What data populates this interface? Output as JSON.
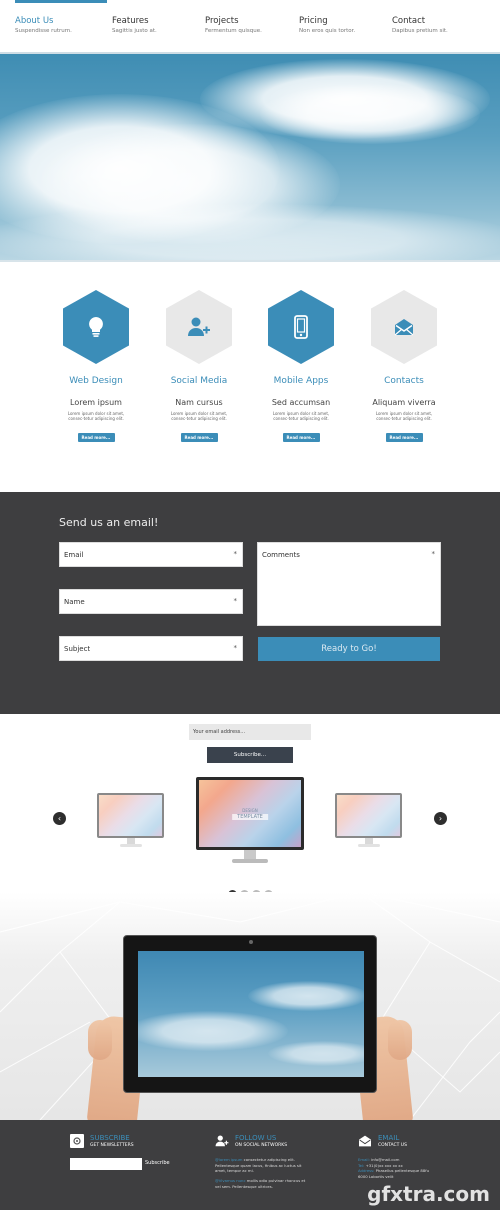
{
  "nav": {
    "items": [
      {
        "title": "About Us",
        "subtitle": "Suspendisse rutrum.",
        "active": true
      },
      {
        "title": "Features",
        "subtitle": "Sagittis justo at.",
        "active": false
      },
      {
        "title": "Projects",
        "subtitle": "Fermentum quisque.",
        "active": false
      },
      {
        "title": "Pricing",
        "subtitle": "Non eros quis tortor.",
        "active": false
      },
      {
        "title": "Contact",
        "subtitle": "Dapibus pretium sit.",
        "active": false
      }
    ]
  },
  "features": [
    {
      "icon": "lightbulb-icon",
      "title": "Web Design",
      "subtitle": "Lorem ipsum",
      "desc": "Lorem ipsum dolor sit amet, consec-tetur adipiscing elit.",
      "button": "Read more..."
    },
    {
      "icon": "add-user-icon",
      "title": "Social Media",
      "subtitle": "Nam cursus",
      "desc": "Lorem ipsum dolor sit amet, consec-tetur adipiscing elit.",
      "button": "Read more..."
    },
    {
      "icon": "smartphone-icon",
      "title": "Mobile Apps",
      "subtitle": "Sed accumsan",
      "desc": "Lorem ipsum dolor sit amet, consec-tetur adipiscing elit.",
      "button": "Read more..."
    },
    {
      "icon": "open-envelope-icon",
      "title": "Contacts",
      "subtitle": "Aliquam viverra",
      "desc": "Lorem ipsum dolor sit amet, consec-tetur adipiscing elit.",
      "button": "Read more..."
    }
  ],
  "contact": {
    "heading": "Send us an email!",
    "fields": {
      "email": "Email",
      "name": "Name",
      "subject": "Subject",
      "comments": "Comments"
    },
    "required_mark": "*",
    "submit": "Ready to Go!"
  },
  "subscribe": {
    "placeholder": "Your email address...",
    "button": "Subscribe..."
  },
  "showcase": {
    "banner_line1": "DESIGN",
    "banner_line2": "TEMPLATE",
    "prev": "‹",
    "next": "›",
    "slides_total": 4,
    "active_slide": 1
  },
  "footer": {
    "subscribe": {
      "heading": "SUBSCRIBE",
      "sub": "GET NEWSLETTERS",
      "button": "Subscribe"
    },
    "follow": {
      "heading": "FOLLOW US",
      "sub": "ON SOCIAL NETWORKS",
      "p1_hl": "@lorem ipsum",
      "p1": " consectetur adipiscing elit. Pellentesque quam lacus, finibus ac luctus sit amet, tempor ac mi.",
      "p2_hl": "@Vivamus nunc",
      "p2": " mollis odio pulvinar rhoncus et vel sem. Pellentesque ultrices."
    },
    "email": {
      "heading": "EMAIL",
      "sub": "CONTACT US",
      "email_label": "Email:",
      "email_value": "info@mail.com",
      "tel_label": "Tel:",
      "tel_value": "+31(0)xx xxx xx xx",
      "address_label": "Address:",
      "address_value": "Phasellus pellentesque 88fu 6000 Lobortis velit"
    }
  },
  "watermark": "gfxtra.com",
  "colors": {
    "accent": "#3b8db8",
    "dark": "#3e3e40",
    "hex_gray": "#e8e8e8"
  }
}
